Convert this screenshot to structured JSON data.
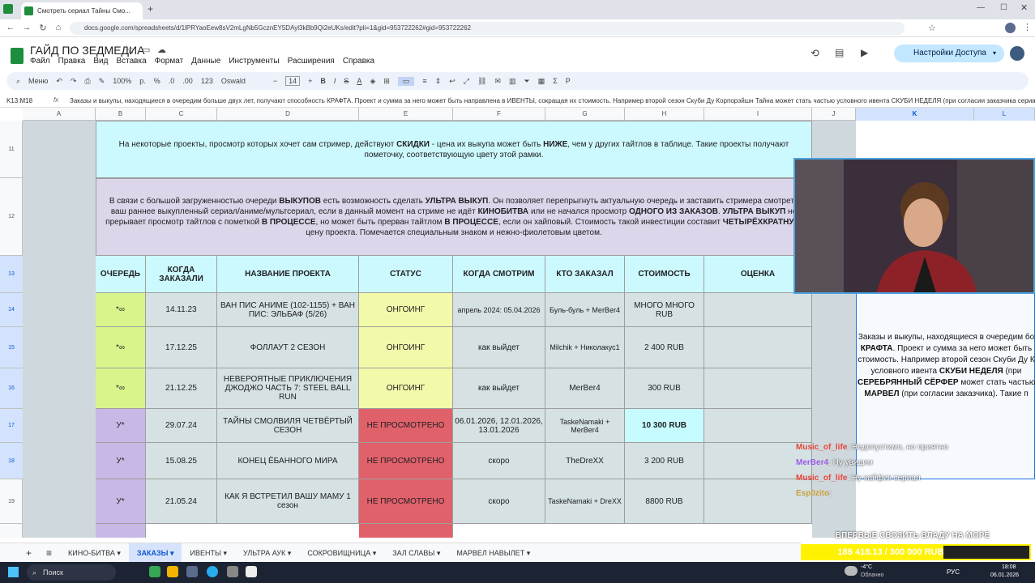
{
  "browser": {
    "tab_title": "Смотреть сериал Тайны Смо...",
    "url": "docs.google.com/spreadsheets/d/1lPRYaoEew8sV2mLgNb5GcznEY5DAyl3kBb9Qi2eUKs/edit?pli=1&gid=953722262#gid=953722262"
  },
  "doc": {
    "title": "ГАЙД ПО ЗЕДМЕДИА",
    "menu": [
      "Файл",
      "Правка",
      "Вид",
      "Вставка",
      "Формат",
      "Данные",
      "Инструменты",
      "Расширения",
      "Справка"
    ],
    "access_button": "Настройки Доступа"
  },
  "toolbar": {
    "menu_label": "Меню",
    "zoom": "100%",
    "currency": "р.",
    "percent": "%",
    "decimals_less": ".0",
    "decimals_more": ".00",
    "number_format": "123",
    "font": "Oswald",
    "font_size": "14"
  },
  "formula_bar": {
    "name_box": "K13:M18",
    "text": "Заказы и выкупы, находящиеся в очередим больше двух лет, получают способность КРАФТА. Проект и сумма за него может  быть направлена в ИВЕНТЫ, сокращая их стоимость. Например второй сезон Скуби Ду Корпорэйшн Тайна может стать частью условного ивента СКУБИ НЕДЕЛЯ (при согласии заказчика сериала), а СЕРЕБРЯННЫЙ"
  },
  "columns": [
    "A",
    "B",
    "C",
    "D",
    "E",
    "F",
    "G",
    "H",
    "I",
    "J",
    "K",
    "L"
  ],
  "rows": [
    "11",
    "12",
    "13",
    "14",
    "15",
    "16",
    "17",
    "18",
    "19"
  ],
  "info11": {
    "p1": "На некоторые проекты, просмотр которых хочет сам стример, действуют ",
    "b1": "СКИДКИ",
    "p2": " - цена их выкупа может быть ",
    "b2": "НИЖЕ",
    "p3": ", чем у других тайтлов в таблице. Такие проекты получают пометочку, соответствующую цвету этой рамки."
  },
  "info12": {
    "p1": "В связи с большой загруженностью очереди ",
    "b1": "ВЫКУПОВ",
    "p2": " есть возможность сделать ",
    "b2": "УЛЬТРА ВЫКУП",
    "p3": ". Он позволяет перепрыгнуть актуальную очередь и заставить стримера смотреть ваш раннее выкупленный сериал/аниме/мультсериал, если в данный момент на стриме не идёт ",
    "b3": "КИНОБИТВА",
    "p4": " или не начался просмотр ",
    "b4": "ОДНОГО ИЗ ЗАКАЗОВ",
    "p5": ". ",
    "b5": "УЛЬТРА ВЫКУП",
    "p6": " не прерывает просмотр тайтлов с пометкой ",
    "b6": "В ПРОЦЕССЕ",
    "p7": ", но может быть прерван тайтлом ",
    "b7": "В ПРОЦЕССЕ",
    "p8": ", если он хайповый. Стоимость такой инвестиции составит ",
    "b8": "ЧЕТЫРЁХКРАТНУЮ",
    "p9": " цену проекта. Помечается специальным знаком и нежно-фиолетовым цветом."
  },
  "table": {
    "headers": [
      "ОЧЕРЕДЬ",
      "КОГДА ЗАКАЗАЛИ",
      "НАЗВАНИЕ ПРОЕКТА",
      "СТАТУС",
      "КОГДА СМОТРИМ",
      "КТО ЗАКАЗАЛ",
      "СТОИМОСТЬ",
      "ОЦЕНКА"
    ],
    "rows": [
      {
        "queue": "*∞",
        "date": "14.11.23",
        "title": "ВАН ПИС АНИМЕ (102-1155) + ВАН ПИС: ЭЛЬБАФ (5/26)",
        "status": "ОНГОИНГ",
        "when": "апрель 2024: 05.04.2026",
        "who": "Буль-буль + MerBer4",
        "cost": "МНОГО МНОГО RUB",
        "rating": ""
      },
      {
        "queue": "*∞",
        "date": "17.12.25",
        "title": "ФОЛЛАУТ 2 СЕЗОН",
        "status": "ОНГОИНГ",
        "when": "как выйдет",
        "who": "Milchik + Николакус1",
        "cost": "2 400 RUB",
        "rating": ""
      },
      {
        "queue": "*∞",
        "date": "21.12.25",
        "title": "НЕВЕРОЯТНЫЕ ПРИКЛЮЧЕНИЯ ДЖОДЖО ЧАСТЬ 7: STEEL BALL RUN",
        "status": "ОНГОИНГ",
        "when": "как выйдет",
        "who": "MerBer4",
        "cost": "300 RUB",
        "rating": ""
      },
      {
        "queue": "У*",
        "date": "29.07.24",
        "title": "ТАЙНЫ СМОЛВИЛЯ ЧЕТВЁРТЫЙ СЕЗОН",
        "status": "НЕ ПРОСМОТРЕНО",
        "when": "06.01.2026, 12.01.2026, 13.01.2026",
        "who": "TaskeNamaki + MerBer4",
        "cost": "10 300 RUB",
        "rating": ""
      },
      {
        "queue": "У*",
        "date": "15.08.25",
        "title": "КОНЕЦ ЁБАННОГО МИРА",
        "status": "НЕ ПРОСМОТРЕНО",
        "when": "скоро",
        "who": "TheDreXX",
        "cost": "3 200 RUB",
        "rating": ""
      },
      {
        "queue": "У*",
        "date": "21.05.24",
        "title": "КАК Я ВСТРЕТИЛ ВАШУ МАМУ 1 сезон",
        "status": "НЕ ПРОСМОТРЕНО",
        "when": "скоро",
        "who": "TaskeNamaki + DreXX",
        "cost": "8800 RUB",
        "rating": ""
      }
    ]
  },
  "side_note": {
    "l1": "Заказы и выкупы, находящиеся в очередим бо",
    "l2a": "КРАФТА",
    "l2b": ". Проект и сумма за него может  быть",
    "l3": "стоимость. Например второй сезон Скуби Ду К",
    "l4a": "условного ивента ",
    "l4b": "СКУБИ НЕДЕЛЯ",
    "l4c": " (при",
    "l5a": "СЕРЕБРЯННЫЙ СЁРФЕР",
    "l5b": " может стать частью",
    "l6a": "МАРВЕЛ",
    "l6b": " (при согласии заказчика). Такие п"
  },
  "chat": [
    {
      "name": "Music_of_life",
      "msg": ": Недопустимо, но приятно",
      "color": "#e8453c"
    },
    {
      "name": "MerBer4",
      "msg": ": Ну увидим",
      "color": "#9b5de5"
    },
    {
      "name": "Music_of_life",
      "msg": ": Ну кайфик сериал",
      "color": "#e8453c"
    },
    {
      "name": "Esp0zito",
      "msg": ":",
      "color": "#c8a23a"
    }
  ],
  "donation": {
    "banner": "ВПЕРВЫЕ СВОЗИТЬ ВЛАДУ НА МОРЕ",
    "text": "186 418.13 / 300 000 RUB",
    "progress": 0.621
  },
  "sheet_tabs": [
    "КИНО-БИТВА",
    "ЗАКАЗЫ",
    "ИВЕНТЫ",
    "УЛЬТРА АУК",
    "СОКРОВИЩНИЦА",
    "ЗАЛ СЛАВЫ",
    "МАРВЕЛ НАВЫЛЕТ"
  ],
  "active_tab": "ЗАКАЗЫ",
  "taskbar": {
    "search": "Поиск",
    "weather_temp": "-4°C",
    "weather_desc": "Облачно",
    "lang": "РУС",
    "time": "18:08",
    "date": "06.01.2026"
  },
  "colors": {
    "teal": "#ccf9fd",
    "lavender": "#dcd6ea",
    "green": "#d8f58c",
    "purple": "#c8b8e6",
    "yellow": "#f2f9a8",
    "red": "#e0616a",
    "cyan": "#c6fbff",
    "rowbg": "#d5e1e2",
    "gray": "#cfd8dc"
  }
}
